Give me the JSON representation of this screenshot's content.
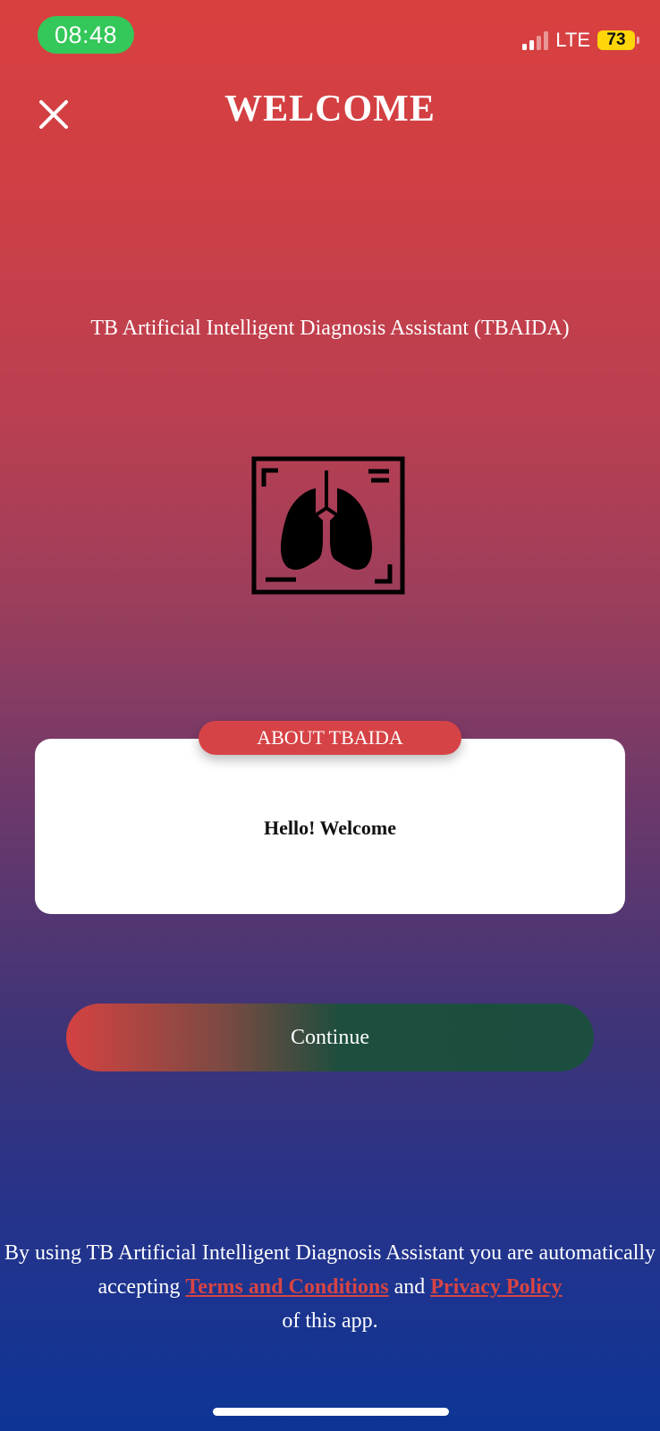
{
  "status_bar": {
    "time": "08:48",
    "network": "LTE",
    "battery": "73"
  },
  "header": {
    "title": "WELCOME",
    "close_icon": "close-icon"
  },
  "app": {
    "name": "TB Artificial Intelligent Diagnosis Assistant (TBAIDA)",
    "icon": "lung-xray-icon"
  },
  "about": {
    "badge": "ABOUT TBAIDA",
    "message": "Hello! Welcome"
  },
  "continue_label": "Continue",
  "legal": {
    "prefix": "By using TB Artificial Intelligent Diagnosis Assistant you are automatically accepting",
    "terms_link": "Terms and Conditions",
    "conjunction": "and",
    "privacy_link": "Privacy Policy",
    "suffix": "of this app."
  },
  "colors": {
    "accent_red": "#d64346",
    "link_red": "#d74444",
    "status_green": "#34c759",
    "battery_yellow": "#ffd60a"
  }
}
